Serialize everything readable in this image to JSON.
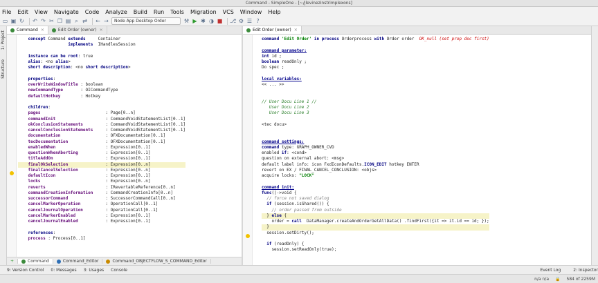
{
  "window": {
    "title": "Command - SimpleOne - [~/jlevinezinstrimplexons]"
  },
  "menu": [
    "File",
    "Edit",
    "View",
    "Navigate",
    "Code",
    "Analyze",
    "Build",
    "Run",
    "Tools",
    "Migration",
    "VCS",
    "Window",
    "Help"
  ],
  "toolbar": {
    "run_config": "Node App Desktop Order",
    "icons": [
      "folder-open-icon",
      "save-icon",
      "sync-icon",
      "undo-icon",
      "redo-icon",
      "cut-icon",
      "copy-icon",
      "paste-icon",
      "find-icon",
      "replace-icon",
      "back-icon",
      "forward-icon",
      "build-icon",
      "run-icon",
      "debug-icon",
      "coverage-icon",
      "stop-icon",
      "vcs-icon",
      "settings-icon",
      "structure-icon",
      "help-icon"
    ]
  },
  "side_panels": {
    "project": "1: Project",
    "structure": "Structure"
  },
  "left_tabs": [
    "Command",
    "Edit Order (owner)"
  ],
  "right_tabs": [
    "Edit Order (owner)"
  ],
  "left_code": [
    "    concept Command extends     Container",
    "                    implements  IHandlesSession",
    "",
    "    instance can be root: true",
    "    alias: <no alias>",
    "    short description: <no short description>",
    "",
    "    properties:",
    "    overWriteWindowTitle : boolean",
    "    newCommandType       : OICommandType",
    "    defaultHotkey        : Hotkey",
    "",
    "    children:",
    "    pages                          : Page[0..n]",
    "    commandInit                    : CommandVoidStatementList[0..1]",
    "    okConclusionStatements         : CommandVoidStatementList[0..1]",
    "    cancelConclusionStatements     : CommandVoidStatementList[0..1]",
    "    documentation                  : OFXDocumentation[0..1]",
    "    tecDocumentation               : OFXDocumentation[0..1]",
    "    enabledWhen                    : Expression[0..1]",
    "    questionWhenAborting           : Expression[0..1]",
    "    titleAddOn                     : Expression[0..1]",
    "    finalOkSelection               : Expression[0..n]",
    "    finalCancelSelection           : Expression[0..n]",
    "    defaultIcon                    : Expression[0..1]",
    "    locks                          : Expression[0..n]",
    "    reverts                        : IRevertableReference[0..n]",
    "    commandCreationInformation     : CommandCreationInfo[0..n]",
    "    successorCommand               : SuccessorCommandCall[0..n]",
    "    cancelMarkerOperation          : OperationCall[0..1]",
    "    cancelJournalOperation         : OperationCall[0..1]",
    "    cancelMarkerEnabled            : Expression[0..1]",
    "    cancelJournalEnabled           : Expression[0..1]",
    "",
    "    references:",
    "    process : Process[0..1]"
  ],
  "right_code": [
    "command 'Edit Order' in process Orderprocess with Order order  OK_null (set prop doc first)",
    "",
    "command parameter:",
    "int id ;",
    "boolean readOnly ;",
    "Do spec ;",
    "",
    "local variables:",
    "<< ... >>",
    "",
    "",
    "// User Docu Line 1 //",
    "   User Docu Line 2",
    "   User Docu Line 3",
    "",
    "<tec docu>",
    "",
    "",
    "command settings:",
    "command type: GRAPH_OWNER_CVD",
    "enabled if: <cond>",
    "question on external abort: <msg>",
    "default label info: icon FxdIconDefaults.ICON_EDIT hotkey ENTER",
    "revert on EX / FINAL_CANCEL_CONCLUSION: <objs>",
    "acquire locks: \"LOCK\"",
    "",
    "command init:",
    "func(|->void {",
    "  // force not saved dialog",
    "  if (session.isShared()) {",
    "    // order passed from outside",
    "  } else {",
    "    order = call  DataManager.createAndOrderGetAllData() .findFirst({it => it.id == id; });",
    "  }",
    "  session.setDirty();",
    "",
    "  if (readOnly) {",
    "    session.setReadOnly(true);"
  ],
  "bottom_tabs": [
    "Command",
    "Command_Editor",
    "Command_OBJECTFLOW_S_COMMAND_Editor"
  ],
  "tool_windows": [
    "9: Version Control",
    "0: Messages",
    "3: Usages",
    "Console",
    "Event Log",
    "2: Inspector"
  ],
  "status": {
    "position": "n/a   n/a",
    "memory": "584 of 2259M"
  }
}
